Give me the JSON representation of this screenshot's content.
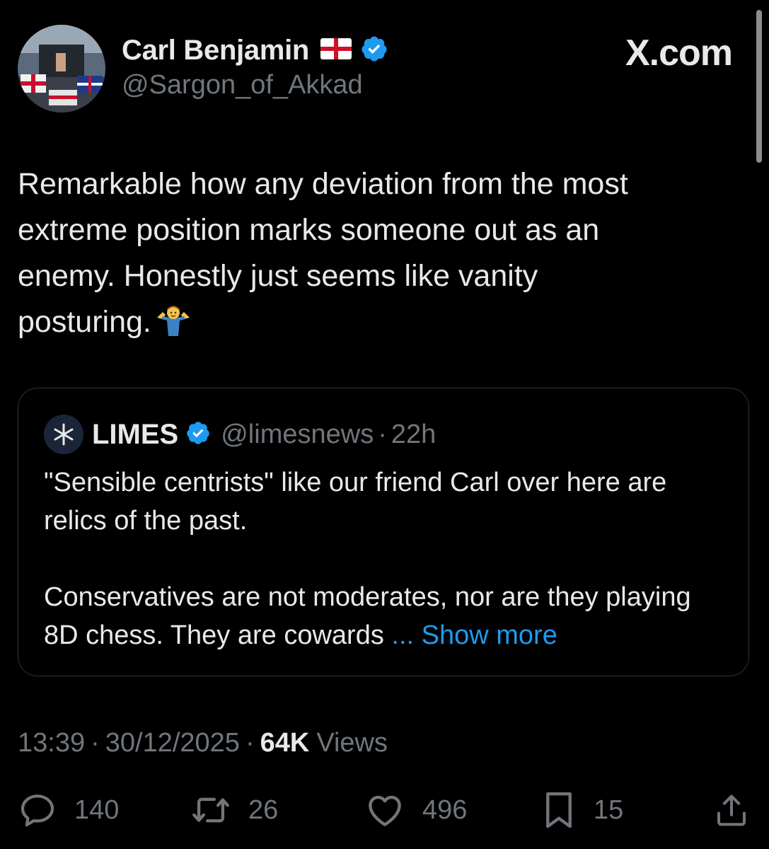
{
  "author": {
    "display_name": "Carl Benjamin",
    "handle": "@Sargon_of_Akkad",
    "flag": "england-flag-icon",
    "verified": "verified-badge-icon"
  },
  "brand": "X.com",
  "tweet": {
    "text": "Remarkable how any deviation from the most\nextreme position marks someone out as an\nenemy. Honestly just seems like vanity\nposturing.",
    "emoji": "person-shrugging-icon"
  },
  "quote": {
    "display_name": "LIMES",
    "handle": "@limesnews",
    "separator": "·",
    "time": "22h",
    "paragraph_1": "\"Sensible centrists\" like our friend Carl over here are relics of the past.",
    "paragraph_2": "Conservatives are not moderates, nor are they playing 8D chess. They are cowards",
    "show_more": "... Show more"
  },
  "meta": {
    "time": "13:39",
    "date": "30/12/2025",
    "separator": "·",
    "views_count": "64K",
    "views_label": "Views"
  },
  "actions": {
    "replies": "140",
    "reposts": "26",
    "likes": "496",
    "bookmarks": "15"
  },
  "colors": {
    "background": "#000000",
    "text": "#e7e9ea",
    "muted": "#71767b",
    "accent": "#1d9bf0",
    "border": "#2f3336"
  }
}
